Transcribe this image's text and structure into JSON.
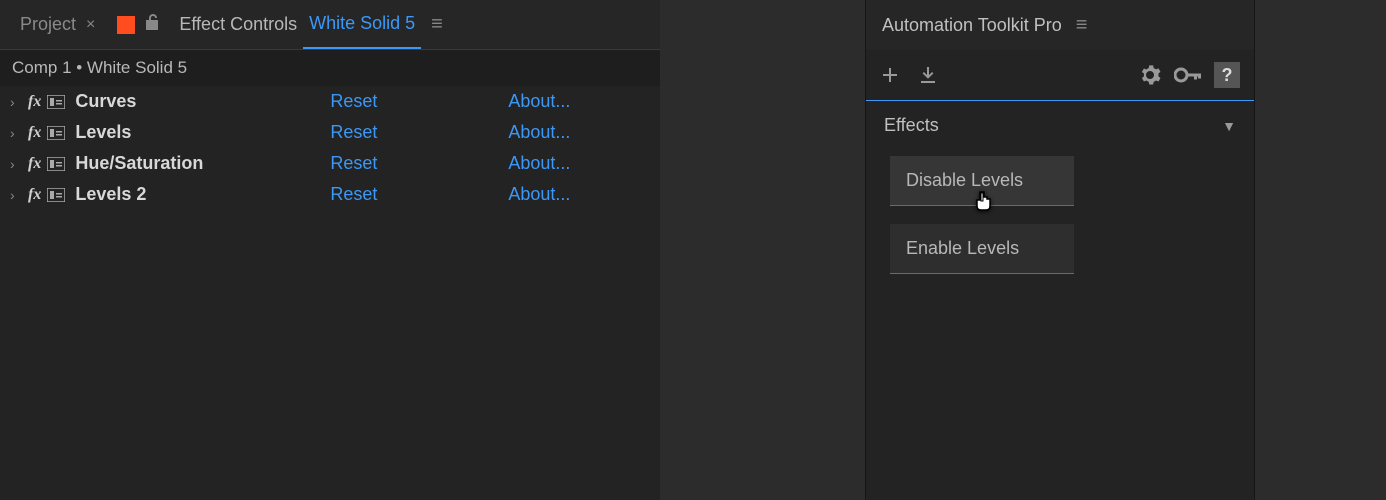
{
  "leftPanel": {
    "tabs": {
      "project": "Project",
      "effectControls": "Effect Controls",
      "layerName": "White Solid 5"
    },
    "breadcrumb": "Comp 1 • White Solid 5",
    "effects": [
      {
        "name": "Curves",
        "reset": "Reset",
        "about": "About..."
      },
      {
        "name": "Levels",
        "reset": "Reset",
        "about": "About..."
      },
      {
        "name": "Hue/Saturation",
        "reset": "Reset",
        "about": "About..."
      },
      {
        "name": "Levels 2",
        "reset": "Reset",
        "about": "About..."
      }
    ]
  },
  "rightPanel": {
    "title": "Automation Toolkit Pro",
    "section": "Effects",
    "buttons": [
      {
        "label": "Disable Levels",
        "hover": true
      },
      {
        "label": "Enable Levels",
        "hover": false
      }
    ]
  }
}
